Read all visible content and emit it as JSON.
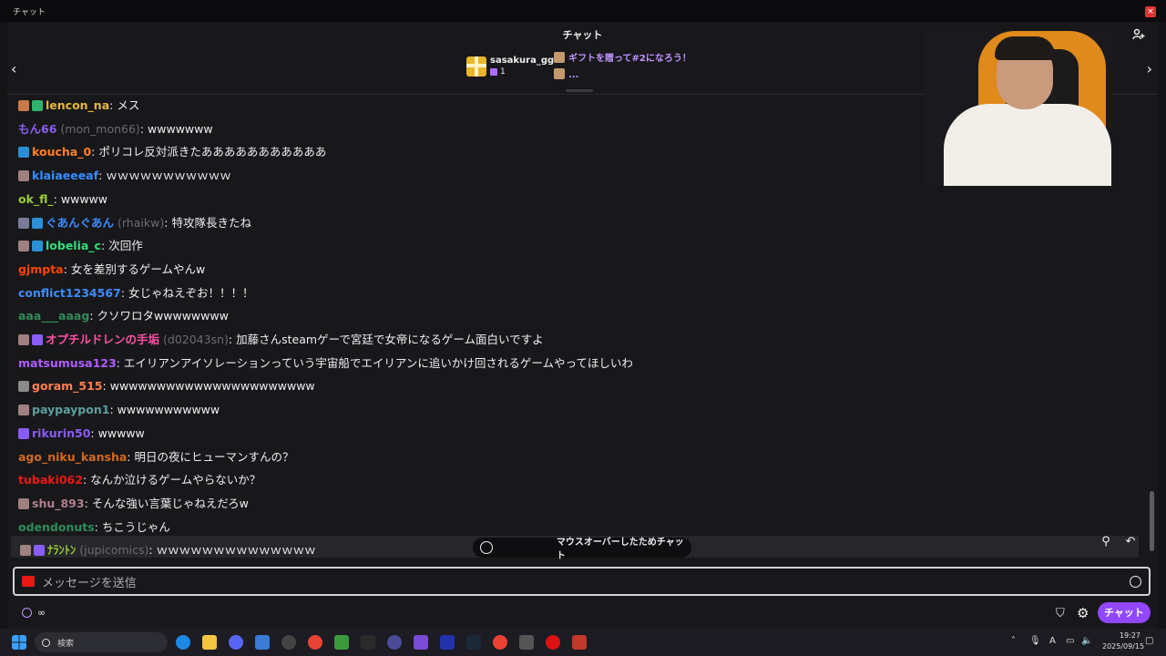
{
  "window": {
    "title": "チャット",
    "close_label": "×"
  },
  "header": {
    "title": "チャット"
  },
  "gift_bar": {
    "top_gifter": "sasakura_gg",
    "gift_count": "1",
    "promo": "ギフトを贈って#2になろう！",
    "promo_sub": "..."
  },
  "messages": [
    {
      "user": "lencon_na",
      "color": "#e8b63a",
      "badges": [
        "#c97a4a",
        "#2fb46e"
      ],
      "alt": "",
      "text": "メス"
    },
    {
      "user": "もん66",
      "color": "#8a5cf6",
      "badges": [],
      "alt": "(mon_mon66)",
      "text": "wwwwwww"
    },
    {
      "user": "koucha_0",
      "color": "#ff7f27",
      "badges": [
        "#2c8fd6"
      ],
      "alt": "",
      "text": "ポリコレ反対派きたあああああああああああ"
    },
    {
      "user": "klaiaeeeaf",
      "color": "#3a8dff",
      "badges": [
        "#a08080"
      ],
      "alt": "",
      "text": "ｗｗｗｗｗｗｗｗｗｗｗ"
    },
    {
      "user": "ok_fl_",
      "color": "#9acd32",
      "badges": [],
      "alt": "",
      "text": "wwwww"
    },
    {
      "user": "ぐあんぐあん",
      "color": "#3a8dff",
      "badges": [
        "#7a7a9a",
        "#2c8fd6"
      ],
      "alt": "(rhaikw)",
      "text": "特攻隊長きたね"
    },
    {
      "user": "lobelia_c",
      "color": "#2fe07a",
      "badges": [
        "#a08080",
        "#2c8fd6"
      ],
      "alt": "",
      "text": "次回作"
    },
    {
      "user": "gjmpta",
      "color": "#ff4500",
      "badges": [],
      "alt": "",
      "text": "女を差別するゲームやんw"
    },
    {
      "user": "conflict1234567",
      "color": "#3a8dff",
      "badges": [],
      "alt": "",
      "text": "女じゃねえぞお！！！！"
    },
    {
      "user": "aaa___aaag",
      "color": "#2e8b57",
      "badges": [],
      "alt": "",
      "text": "クソワロタwwwwwwww"
    },
    {
      "user": "オプチルドレンの手垢",
      "color": "#ff4fa3",
      "badges": [
        "#a08080",
        "#8a5cf6"
      ],
      "alt": "(d02043sn)",
      "text": "加藤さんsteamゲーで宮廷で女帝になるゲーム面白いですよ"
    },
    {
      "user": "matsumusa123",
      "color": "#b05cff",
      "badges": [],
      "alt": "",
      "text": "エイリアンアイソレーションっていう宇宙船でエイリアンに追いかけ回されるゲームやってほしいわ"
    },
    {
      "user": "goram_515",
      "color": "#ff7f50",
      "badges": [
        "#8a8a8a"
      ],
      "alt": "",
      "text": "wwwwwwwwwwwwwwwwwwwwww"
    },
    {
      "user": "paypaypon1",
      "color": "#5f9ea0",
      "badges": [
        "#a08080"
      ],
      "alt": "",
      "text": "wwwwwwwwwww"
    },
    {
      "user": "rikurin50",
      "color": "#8a5cf6",
      "badges": [
        "#8a5cf6"
      ],
      "alt": "",
      "text": "wwwww"
    },
    {
      "user": "ago_niku_kansha",
      "color": "#d2691e",
      "badges": [],
      "alt": "",
      "text": "明日の夜にヒューマンすんの？"
    },
    {
      "user": "tubaki062",
      "color": "#e91916",
      "badges": [],
      "alt": "",
      "text": "なんか泣けるゲームやらないか？"
    },
    {
      "user": "shu_893",
      "color": "#b08090",
      "badges": [
        "#a08080"
      ],
      "alt": "",
      "text": "そんな強い言葉じゃねえだろw"
    },
    {
      "user": "odendonuts",
      "color": "#2e8b57",
      "badges": [],
      "alt": "",
      "text": "ちこうじゃん"
    },
    {
      "user": "ﾅﾗﾝﾄﾝ",
      "color": "#9acd32",
      "badges": [
        "#a08080",
        "#8a5cf6"
      ],
      "alt": "(jupicomics)",
      "text": "ｗｗｗｗｗｗｗｗｗｗｗｗｗｗ"
    }
  ],
  "paused_notice": "マウスオーバーしたためチャット",
  "input": {
    "placeholder": "メッセージを送信"
  },
  "points": {
    "value": "∞"
  },
  "chat_button": "チャット",
  "taskbar": {
    "search_placeholder": "検索",
    "ime": "A",
    "time": "19:27",
    "date": "2025/09/15"
  },
  "colors": {
    "accent": "#9147ff",
    "background": "#18181b",
    "text": "#efeff1"
  }
}
